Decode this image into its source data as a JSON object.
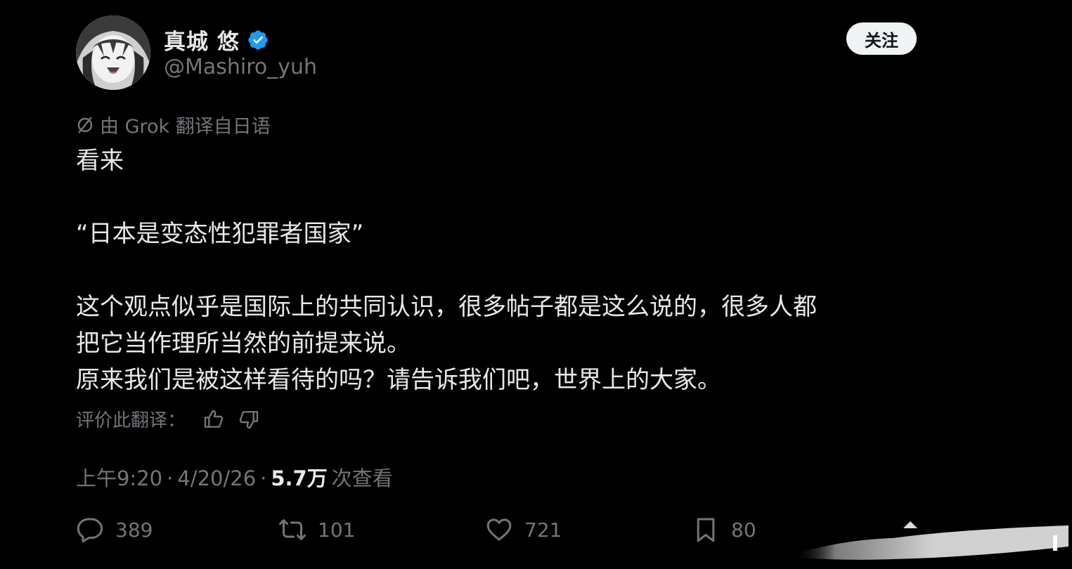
{
  "author": {
    "display_name": "真城 悠",
    "handle": "@Mashiro_yuh",
    "verified_icon": "verified-badge-icon",
    "avatar_icon": "anime-avatar"
  },
  "follow_button": {
    "label": "关注"
  },
  "translation": {
    "icon": "grok-translate-icon",
    "label": "由 Grok 翻译自日语",
    "rate_label": "评价此翻译："
  },
  "tweet": {
    "lines": [
      "看来",
      "“日本是变态性犯罪者国家”",
      "这个观点似乎是国际上的共同认识，很多帖子都是这么说的，很多人都",
      "把它当作理所当然的前提来说。",
      "原来我们是被这样看待的吗？请告诉我们吧，世界上的大家。"
    ]
  },
  "meta": {
    "time": "上午9:20",
    "separator": "·",
    "date": "4/20/26",
    "separator2": "·",
    "views_count": "5.7万",
    "views_label": "次查看"
  },
  "actions": {
    "replies": "389",
    "reposts": "101",
    "likes": "721",
    "bookmarks": "80"
  },
  "colors": {
    "background": "#000000",
    "text_primary": "#e7e9ea",
    "text_secondary": "#71767b",
    "verified_blue": "#1d9bf0",
    "follow_button_bg": "#eff3f4"
  }
}
